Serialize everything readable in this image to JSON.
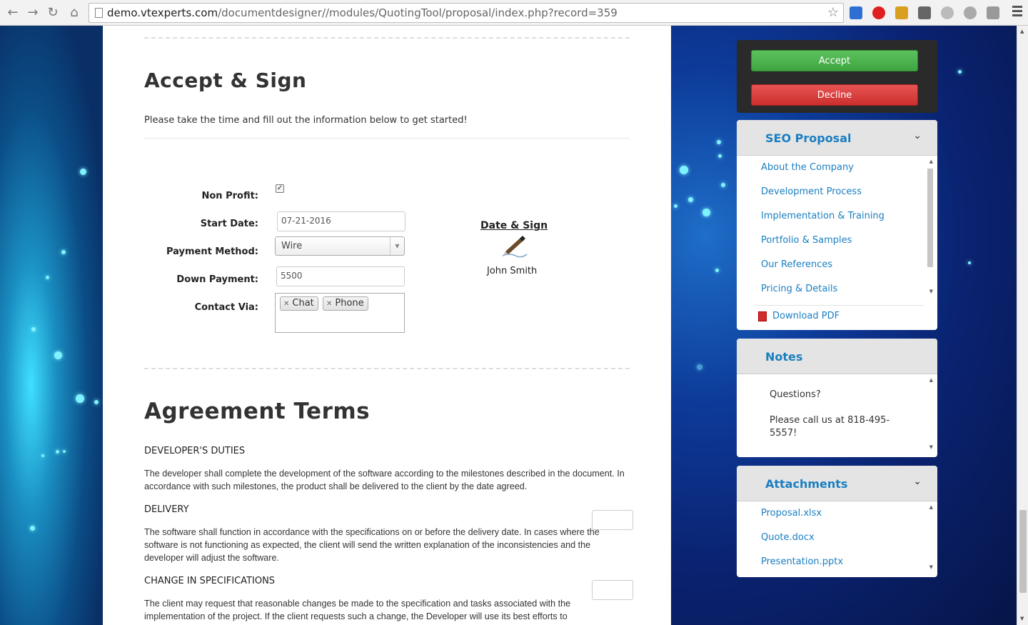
{
  "browser": {
    "url_host": "demo.vtexperts.com",
    "url_path": "/documentdesigner//modules/QuotingTool/proposal/index.php?record=359"
  },
  "accept_section": {
    "title": "Accept & Sign",
    "intro": "Please take the time and fill out the information below to get started!",
    "fields": {
      "non_profit_label": "Non Profit:",
      "non_profit_checked": true,
      "start_date_label": "Start Date:",
      "start_date_value": "07-21-2016",
      "payment_method_label": "Payment Method:",
      "payment_method_value": "Wire",
      "down_payment_label": "Down Payment:",
      "down_payment_value": "5500",
      "contact_via_label": "Contact Via:",
      "contact_via_tags": [
        "Chat",
        "Phone"
      ]
    },
    "signature": {
      "title": "Date & Sign",
      "name": "John Smith"
    }
  },
  "terms_section": {
    "title": "Agreement Terms",
    "items": [
      {
        "heading": "DEVELOPER'S DUTIES",
        "text": "The developer shall complete the development of the software according to the milestones described in the document. In accordance with such milestones, the product shall be delivered to the client by the date agreed."
      },
      {
        "heading": "DELIVERY",
        "text": "The software shall function in accordance with the specifications on or before the delivery date. In cases where the software is not functioning as expected, the client will send the written explanation of the inconsistencies and the developer will adjust the software."
      },
      {
        "heading": "CHANGE IN SPECIFICATIONS",
        "text": "The client may request that reasonable changes be made to the specification and tasks associated with the implementation of the project. If the client requests such a change, the Developer will use its best efforts to"
      }
    ]
  },
  "sidebar": {
    "accept_label": "Accept",
    "decline_label": "Decline",
    "seo_panel": {
      "title": "SEO Proposal",
      "links": [
        "About the Company",
        "Development Process",
        "Implementation & Training",
        "Portfolio & Samples",
        "Our References",
        "Pricing & Details"
      ],
      "download_label": "Download PDF"
    },
    "notes_panel": {
      "title": "Notes",
      "line1": "Questions?",
      "line2": "Please call us at 818-495-5557!"
    },
    "attachments_panel": {
      "title": "Attachments",
      "files": [
        "Proposal.xlsx",
        "Quote.docx",
        "Presentation.pptx"
      ]
    }
  },
  "colors": {
    "link": "#1a7fc1",
    "accept": "#3ea540",
    "decline": "#cc2f2d"
  }
}
